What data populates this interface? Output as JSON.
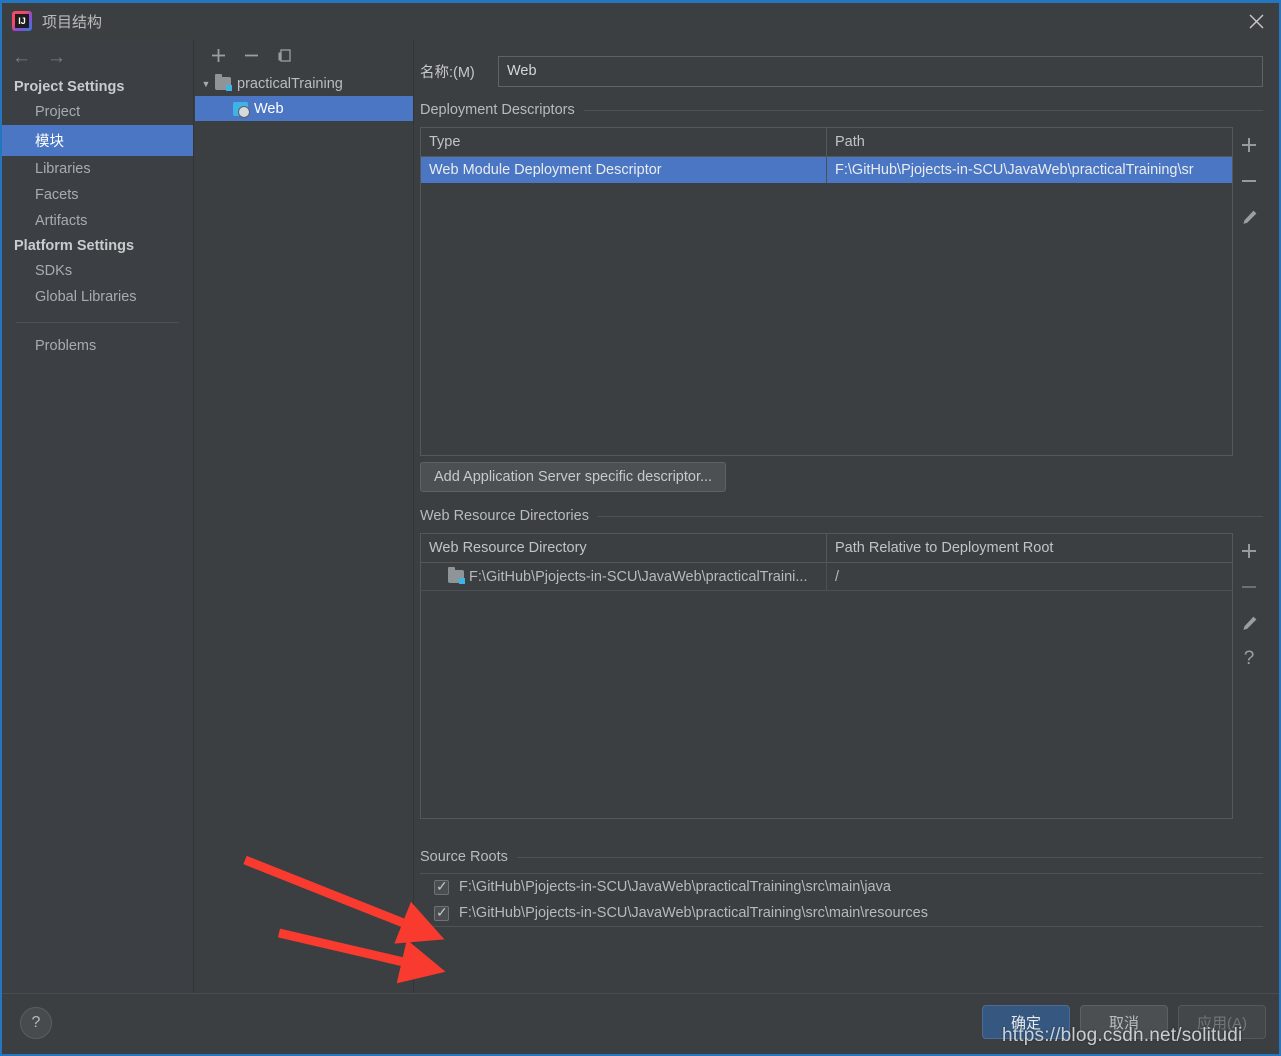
{
  "window": {
    "title": "项目结构",
    "app_icon": "intellij-idea-icon",
    "close_icon": "close-icon"
  },
  "nav": {
    "back_icon": "arrow-left-icon",
    "forward_icon": "arrow-right-icon"
  },
  "sidebar": {
    "groups": [
      {
        "label": "Project Settings",
        "items": [
          {
            "label": "Project",
            "selected": false
          },
          {
            "label": "模块",
            "selected": true
          },
          {
            "label": "Libraries",
            "selected": false
          },
          {
            "label": "Facets",
            "selected": false
          },
          {
            "label": "Artifacts",
            "selected": false
          }
        ]
      },
      {
        "label": "Platform Settings",
        "items": [
          {
            "label": "SDKs",
            "selected": false
          },
          {
            "label": "Global Libraries",
            "selected": false
          }
        ]
      }
    ],
    "extra_items": [
      {
        "label": "Problems",
        "selected": false
      }
    ]
  },
  "tree": {
    "toolbar": [
      {
        "name": "add-module-button",
        "glyph": "+"
      },
      {
        "name": "remove-module-button",
        "glyph": "−"
      },
      {
        "name": "copy-module-button",
        "glyph": "copy-icon"
      }
    ],
    "nodes": [
      {
        "label": "practicalTraining",
        "icon": "folder-icon",
        "expanded": true,
        "selected": false,
        "depth": 0
      },
      {
        "label": "Web",
        "icon": "web-module-icon",
        "expanded": false,
        "selected": true,
        "depth": 1
      }
    ]
  },
  "main": {
    "name_field": {
      "label": "名称:(M)",
      "value": "Web",
      "placeholder": ""
    },
    "deployment_descriptors": {
      "title": "Deployment Descriptors",
      "columns": [
        "Type",
        "Path"
      ],
      "rows": [
        {
          "type": "Web Module Deployment Descriptor",
          "path": "F:\\GitHub\\Pjojects-in-SCU\\JavaWeb\\practicalTraining\\sr",
          "selected": true
        }
      ],
      "tools": [
        {
          "name": "add-descriptor-button",
          "glyph": "+"
        },
        {
          "name": "remove-descriptor-button",
          "glyph": "−"
        },
        {
          "name": "edit-descriptor-button",
          "glyph": "pencil-icon"
        }
      ],
      "add_button_label": "Add Application Server specific descriptor..."
    },
    "web_resource_directories": {
      "title": "Web Resource Directories",
      "columns": [
        "Web Resource Directory",
        "Path Relative to Deployment Root"
      ],
      "rows": [
        {
          "directory": "F:\\GitHub\\Pjojects-in-SCU\\JavaWeb\\practicalTraini...",
          "relative_path": "/",
          "icon": "folder-icon"
        }
      ],
      "tools": [
        {
          "name": "add-web-resource-button",
          "glyph": "+"
        },
        {
          "name": "remove-web-resource-button",
          "glyph": "−"
        },
        {
          "name": "edit-web-resource-button",
          "glyph": "pencil-icon"
        },
        {
          "name": "help-web-resource-button",
          "glyph": "?"
        }
      ]
    },
    "source_roots": {
      "title": "Source Roots",
      "rows": [
        {
          "path": "F:\\GitHub\\Pjojects-in-SCU\\JavaWeb\\practicalTraining\\src\\main\\java",
          "checked": true
        },
        {
          "path": "F:\\GitHub\\Pjojects-in-SCU\\JavaWeb\\practicalTraining\\src\\main\\resources",
          "checked": true
        }
      ]
    }
  },
  "footer": {
    "help_glyph": "?",
    "ok_label": "确定",
    "cancel_label": "取消",
    "apply_label": "应用(A)"
  },
  "overlay": {
    "watermark": "https://blog.csdn.net/solitudi",
    "annotation_color": "#f93a2f",
    "annotation_count": 2
  },
  "colors": {
    "accent_selection": "#4a76c4",
    "window_border": "#2675bf",
    "panel_bg": "#3c3f41",
    "sidebar_bg": "#3c4044",
    "primary_button": "#365880"
  }
}
